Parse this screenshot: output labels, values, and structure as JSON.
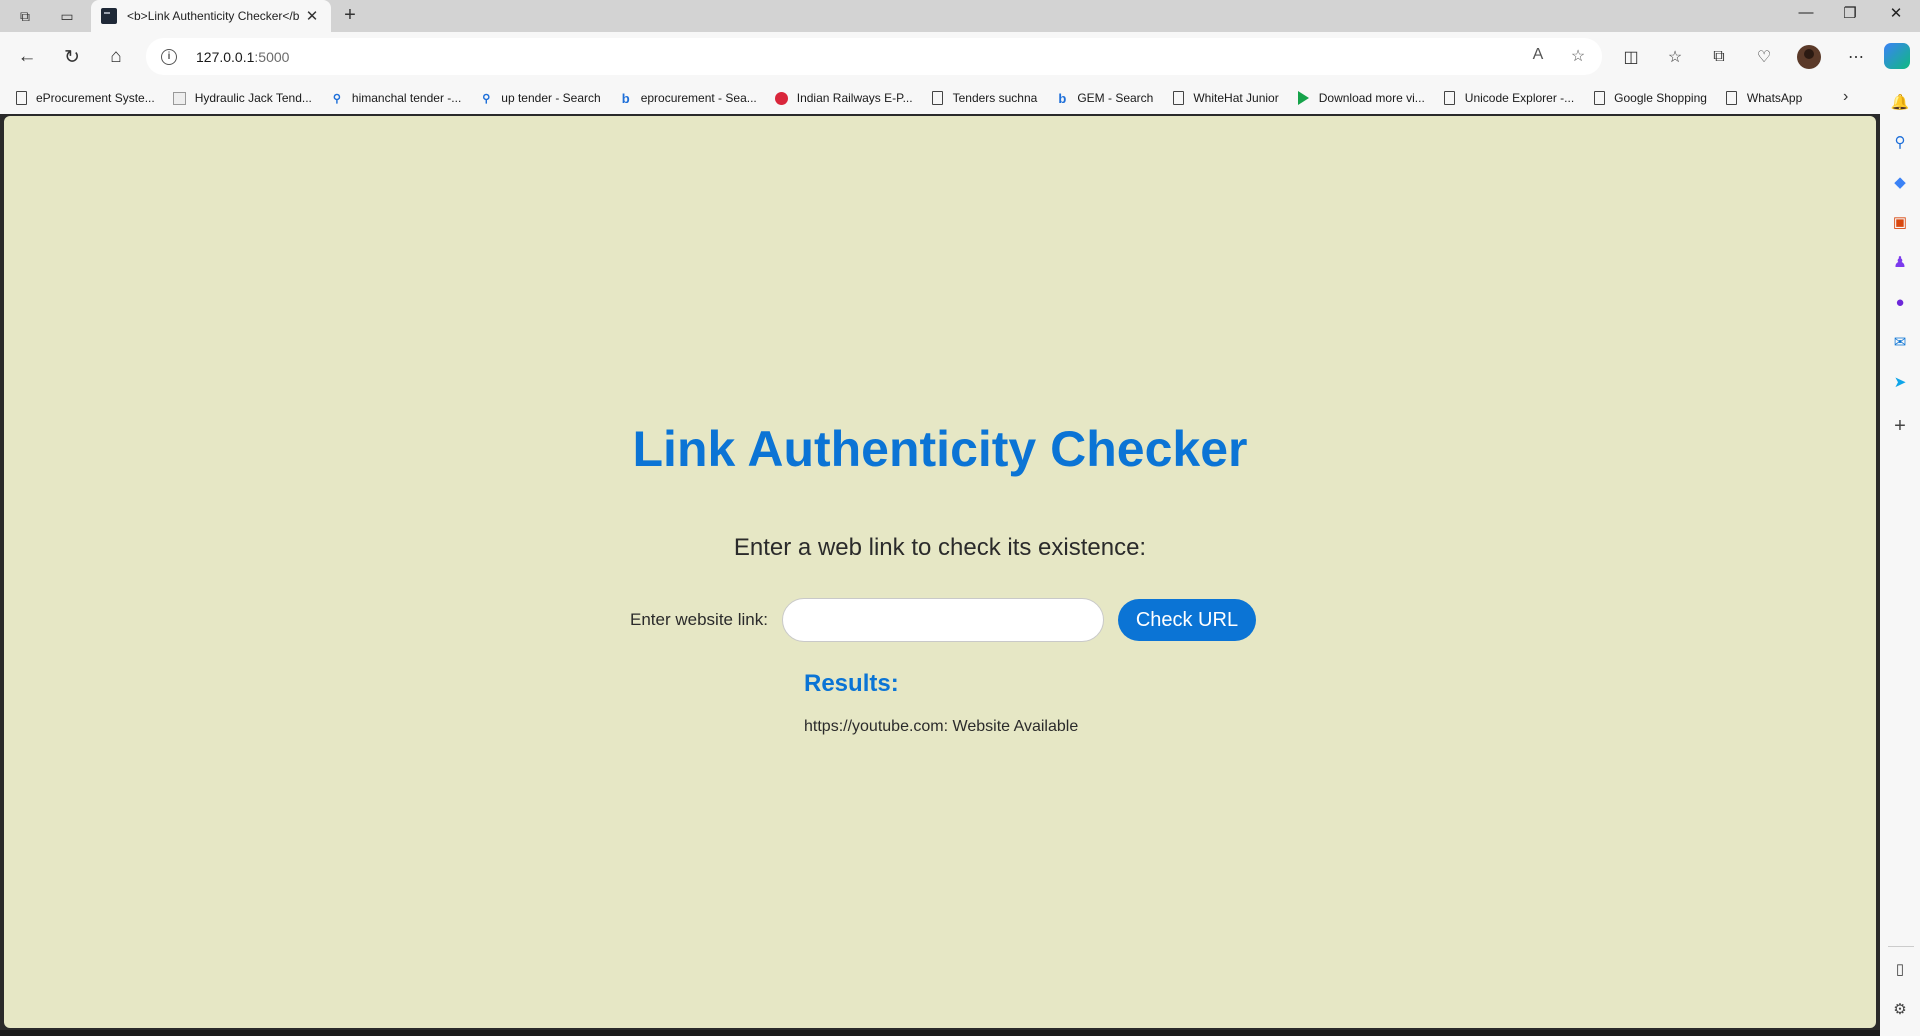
{
  "browser": {
    "tab_title": "<b>Link Authenticity Checker</b>",
    "url_host": "127.0.0.1",
    "url_port": ":5000",
    "favorites": [
      {
        "label": "eProcurement Syste...",
        "icon": "page-icon"
      },
      {
        "label": "Hydraulic Jack Tend...",
        "icon": "image-icon"
      },
      {
        "label": "himanchal tender -...",
        "icon": "search-icon"
      },
      {
        "label": "up tender - Search",
        "icon": "search-icon"
      },
      {
        "label": "eprocurement - Sea...",
        "icon": "bing-icon"
      },
      {
        "label": "Indian Railways E-P...",
        "icon": "railways-icon"
      },
      {
        "label": "Tenders suchna",
        "icon": "page-icon"
      },
      {
        "label": "GEM - Search",
        "icon": "bing-icon"
      },
      {
        "label": "WhiteHat Junior",
        "icon": "page-icon"
      },
      {
        "label": "Download more vi...",
        "icon": "play-icon"
      },
      {
        "label": "Unicode Explorer -...",
        "icon": "page-icon"
      },
      {
        "label": "Google Shopping",
        "icon": "page-icon"
      },
      {
        "label": "WhatsApp",
        "icon": "page-icon"
      }
    ]
  },
  "page": {
    "title": "Link Authenticity Checker",
    "subtitle": "Enter a web link to check its existence:",
    "form": {
      "label": "Enter website link:",
      "input_value": "",
      "button_label": "Check URL"
    },
    "results": {
      "heading": "Results:",
      "items": [
        "https://youtube.com: Website Available"
      ]
    }
  },
  "colors": {
    "accent": "#0b74d5",
    "page_background": "#e6e7c5"
  }
}
